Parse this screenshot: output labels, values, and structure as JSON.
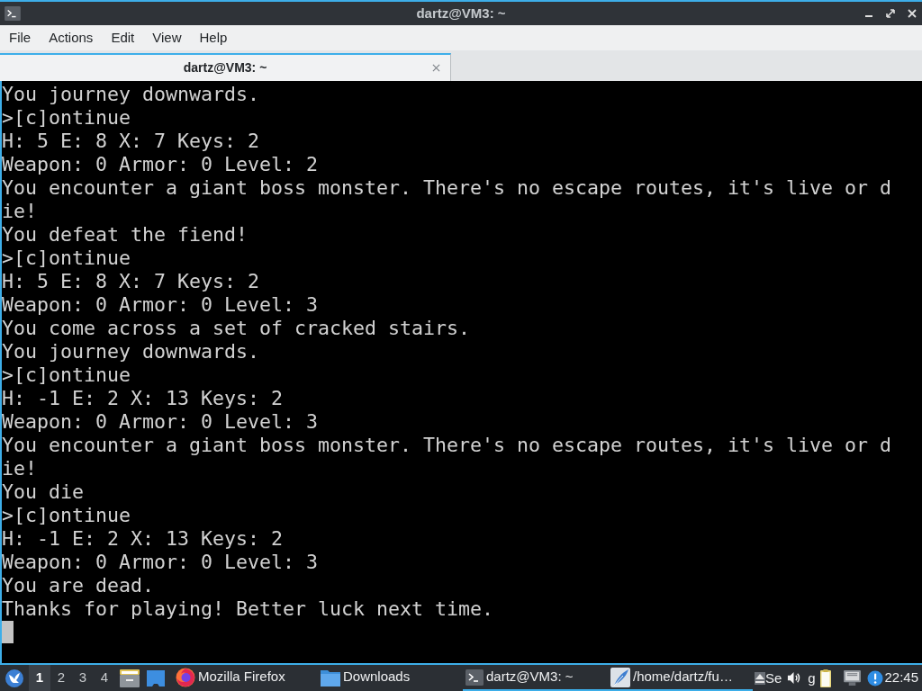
{
  "window": {
    "title": "dartz@VM3: ~"
  },
  "menu": [
    "File",
    "Actions",
    "Edit",
    "View",
    "Help"
  ],
  "tabs": [
    {
      "label": "dartz@VM3: ~",
      "selected": true
    }
  ],
  "terminal": {
    "lines": [
      "You journey downwards.",
      ">[c]ontinue",
      "H: 5 E: 8 X: 7 Keys: 2",
      "Weapon: 0 Armor: 0 Level: 2",
      "You encounter a giant boss monster. There's no escape routes, it's live or die!",
      "You defeat the fiend!",
      ">[c]ontinue",
      "H: 5 E: 8 X: 7 Keys: 2",
      "Weapon: 0 Armor: 0 Level: 3",
      "You come across a set of cracked stairs.",
      "You journey downwards.",
      ">[c]ontinue",
      "H: -1 E: 2 X: 13 Keys: 2",
      "Weapon: 0 Armor: 0 Level: 3",
      "You encounter a giant boss monster. There's no escape routes, it's live or die!",
      "You die",
      ">[c]ontinue",
      "H: -1 E: 2 X: 13 Keys: 2",
      "Weapon: 0 Armor: 0 Level: 3",
      "You are dead.",
      "Thanks for playing! Better luck next time."
    ]
  },
  "taskbar": {
    "desktops": [
      {
        "label": "1",
        "selected": true
      },
      {
        "label": "2",
        "selected": false
      },
      {
        "label": "3",
        "selected": false
      },
      {
        "label": "4",
        "selected": false
      }
    ],
    "tasks": [
      {
        "kind": "browser",
        "label": "Mozilla Firefox",
        "active": false
      },
      {
        "kind": "folder",
        "label": "Downloads",
        "active": false
      },
      {
        "kind": "terminal",
        "label": "dartz@VM3: ~",
        "active": true
      },
      {
        "kind": "editor",
        "label": "/home/dartz/fu…",
        "active": true
      }
    ],
    "tray": [
      {
        "kind": "eject",
        "label": "Se"
      },
      {
        "kind": "volume"
      },
      {
        "kind": "text",
        "label": "g"
      },
      {
        "kind": "clipboard"
      },
      {
        "kind": "network"
      },
      {
        "kind": "notification"
      }
    ],
    "clock": "22:45"
  }
}
